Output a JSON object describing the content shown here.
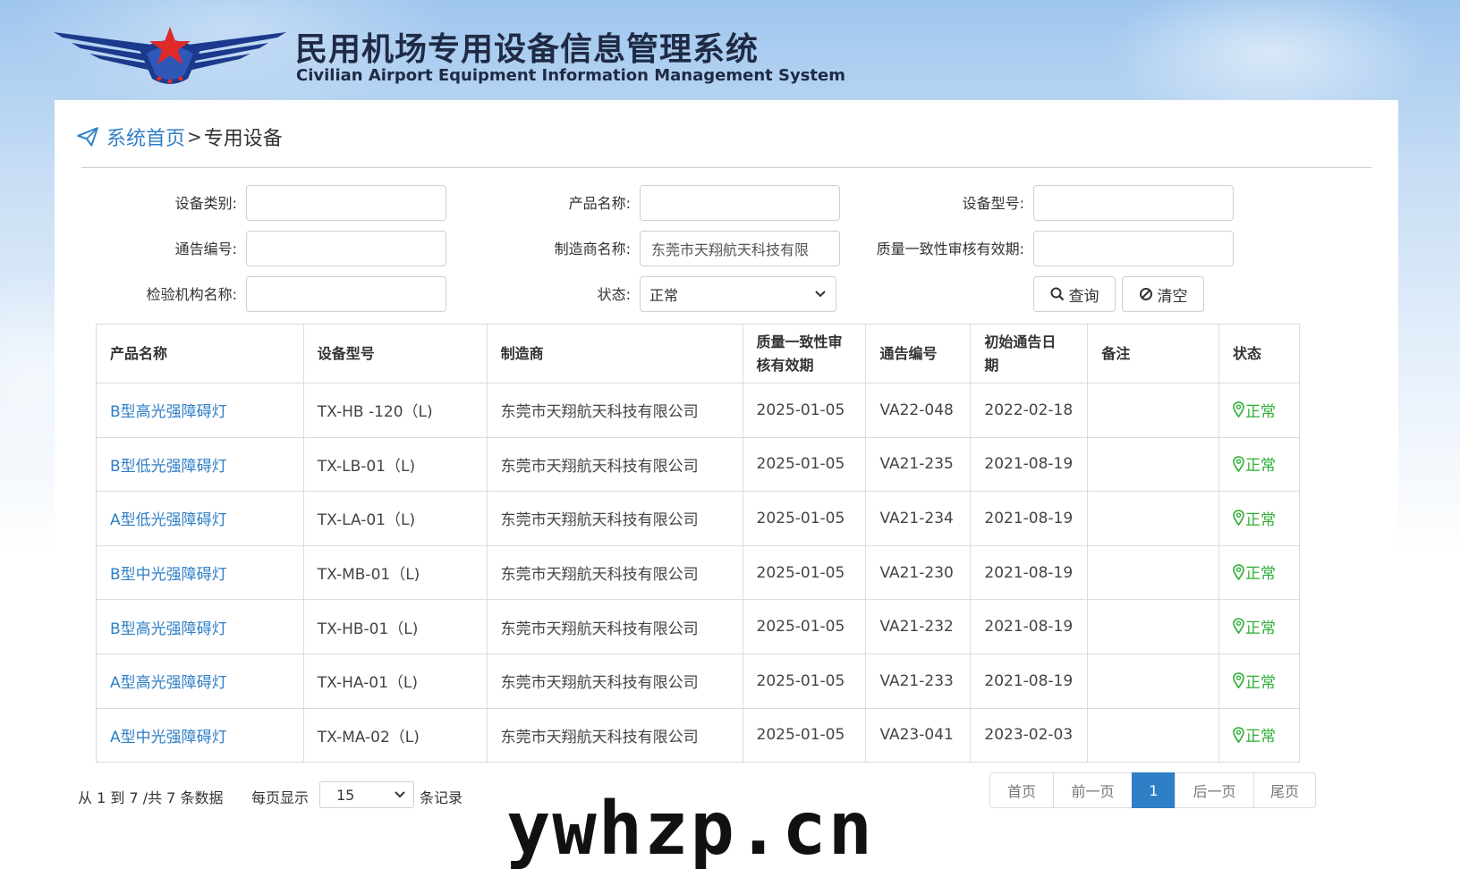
{
  "header": {
    "title_cn": "民用机场专用设备信息管理系统",
    "title_en": "Civilian Airport Equipment Information Management System",
    "logo_icon": "winged-star-logo"
  },
  "breadcrumb": {
    "home": "系统首页",
    "separator": ">",
    "current": "专用设备"
  },
  "search": {
    "equip_category": {
      "label": "设备类别:",
      "value": ""
    },
    "product_name": {
      "label": "产品名称:",
      "value": ""
    },
    "equip_model": {
      "label": "设备型号:",
      "value": ""
    },
    "notice_no": {
      "label": "通告编号:",
      "value": ""
    },
    "manufacturer": {
      "label": "制造商名称:",
      "value": "东莞市天翔航天科技有限"
    },
    "validity": {
      "label": "质量一致性审核有效期:",
      "value": ""
    },
    "inspector": {
      "label": "检验机构名称:",
      "value": ""
    },
    "status": {
      "label": "状态:",
      "value": "正常"
    },
    "query_btn": "查询",
    "clear_btn": "清空"
  },
  "table": {
    "headers": [
      "产品名称",
      "设备型号",
      "制造商",
      "质量一致性审核有效期",
      "通告编号",
      "初始通告日期",
      "备注",
      "状态"
    ],
    "headers_display": [
      "产品名称",
      "设备型号",
      "制造商",
      "质量一致性审\n核有效期",
      "通告编号",
      "初始通告日\n期",
      "备注",
      "状态"
    ],
    "rows": [
      [
        "B型高光强障碍灯",
        "TX-HB -120（L)",
        "东莞市天翔航天科技有限公司",
        "2025-01-05",
        "VA22-048",
        "2022-02-18",
        "",
        "正常"
      ],
      [
        "B型低光强障碍灯",
        "TX-LB-01（L)",
        "东莞市天翔航天科技有限公司",
        "2025-01-05",
        "VA21-235",
        "2021-08-19",
        "",
        "正常"
      ],
      [
        "A型低光强障碍灯",
        "TX-LA-01（L)",
        "东莞市天翔航天科技有限公司",
        "2025-01-05",
        "VA21-234",
        "2021-08-19",
        "",
        "正常"
      ],
      [
        "B型中光强障碍灯",
        "TX-MB-01（L)",
        "东莞市天翔航天科技有限公司",
        "2025-01-05",
        "VA21-230",
        "2021-08-19",
        "",
        "正常"
      ],
      [
        "B型高光强障碍灯",
        "TX-HB-01（L)",
        "东莞市天翔航天科技有限公司",
        "2025-01-05",
        "VA21-232",
        "2021-08-19",
        "",
        "正常"
      ],
      [
        "A型高光强障碍灯",
        "TX-HA-01（L)",
        "东莞市天翔航天科技有限公司",
        "2025-01-05",
        "VA21-233",
        "2021-08-19",
        "",
        "正常"
      ],
      [
        "A型中光强障碍灯",
        "TX-MA-02（L)",
        "东莞市天翔航天科技有限公司",
        "2025-01-05",
        "VA23-041",
        "2023-02-03",
        "",
        "正常"
      ]
    ]
  },
  "footer": {
    "range_text": "从 1 到 7 /共 7 条数据",
    "per_page_label": "每页显示",
    "per_page_value": "15",
    "per_page_suffix": "条记录",
    "pager": [
      "首页",
      "前一页",
      "1",
      "后一页",
      "尾页"
    ],
    "current_page": "1"
  },
  "watermark": "ywhzp.cn",
  "colors": {
    "link": "#2f7fc6",
    "status_ok": "#2dae34",
    "title": "#1f2a44",
    "logo_blue": "#1c3a8c",
    "logo_red": "#e02a2a"
  }
}
